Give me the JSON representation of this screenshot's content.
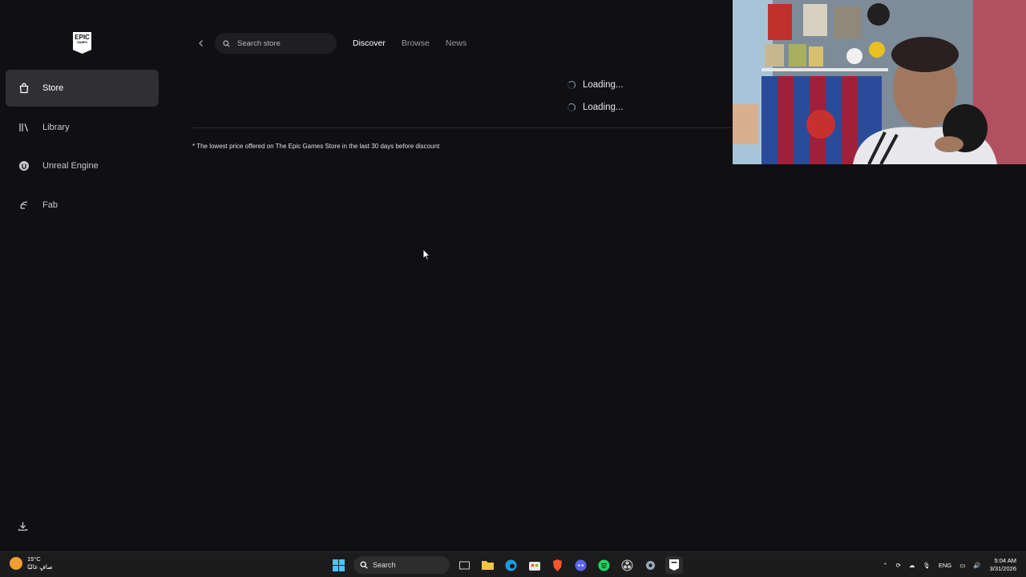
{
  "sidebar": {
    "logo": {
      "line1": "EPIC",
      "line2": "GAMES"
    },
    "items": [
      {
        "label": "Store",
        "icon": "store-bag-icon",
        "active": true
      },
      {
        "label": "Library",
        "icon": "library-icon",
        "active": false
      },
      {
        "label": "Unreal Engine",
        "icon": "unreal-engine-icon",
        "active": false
      },
      {
        "label": "Fab",
        "icon": "fab-icon",
        "active": false
      }
    ],
    "download_icon": "download-icon"
  },
  "header": {
    "search_placeholder": "Search store",
    "tabs": [
      {
        "label": "Discover",
        "active": true
      },
      {
        "label": "Browse",
        "active": false
      },
      {
        "label": "News",
        "active": false
      }
    ]
  },
  "main": {
    "loading": [
      "Loading...",
      "Loading..."
    ],
    "footnote": "* The lowest price offered on The Epic Games Store in the last 30 days before discount"
  },
  "taskbar": {
    "weather": {
      "temp": "15°C",
      "condition": "صافٍ غالبًا"
    },
    "search_label": "Search",
    "tray": {
      "language": "ENG",
      "time": "5:04 AM",
      "date": "3/31/2026"
    }
  },
  "colors": {
    "background": "#101014",
    "active_nav": "#303034",
    "accent": "#ffffff"
  }
}
